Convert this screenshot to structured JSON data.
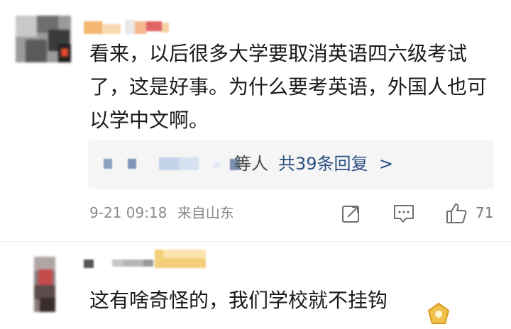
{
  "comment1": {
    "text": "看来，以后很多大学要取消英语四六级考试了，这是好事。为什么要考英语，外国人也可以学中文啊。",
    "reply_preview": {
      "suffix": "等人",
      "count_label": "共39条回复",
      "chevron": ">"
    },
    "time": "9-21 09:18",
    "location": "来自山东",
    "like_count": "71"
  },
  "comment2": {
    "text": "这有啥奇怪的，我们学校就不挂钩"
  },
  "icons": [
    "forward-icon",
    "comment-icon",
    "like-icon",
    "badge-icon"
  ],
  "colors": {
    "link": "#2b4f82",
    "meta": "#8a8a8a",
    "reply_bg": "#f5f5f5",
    "name_highlight": "#f5c98b"
  }
}
